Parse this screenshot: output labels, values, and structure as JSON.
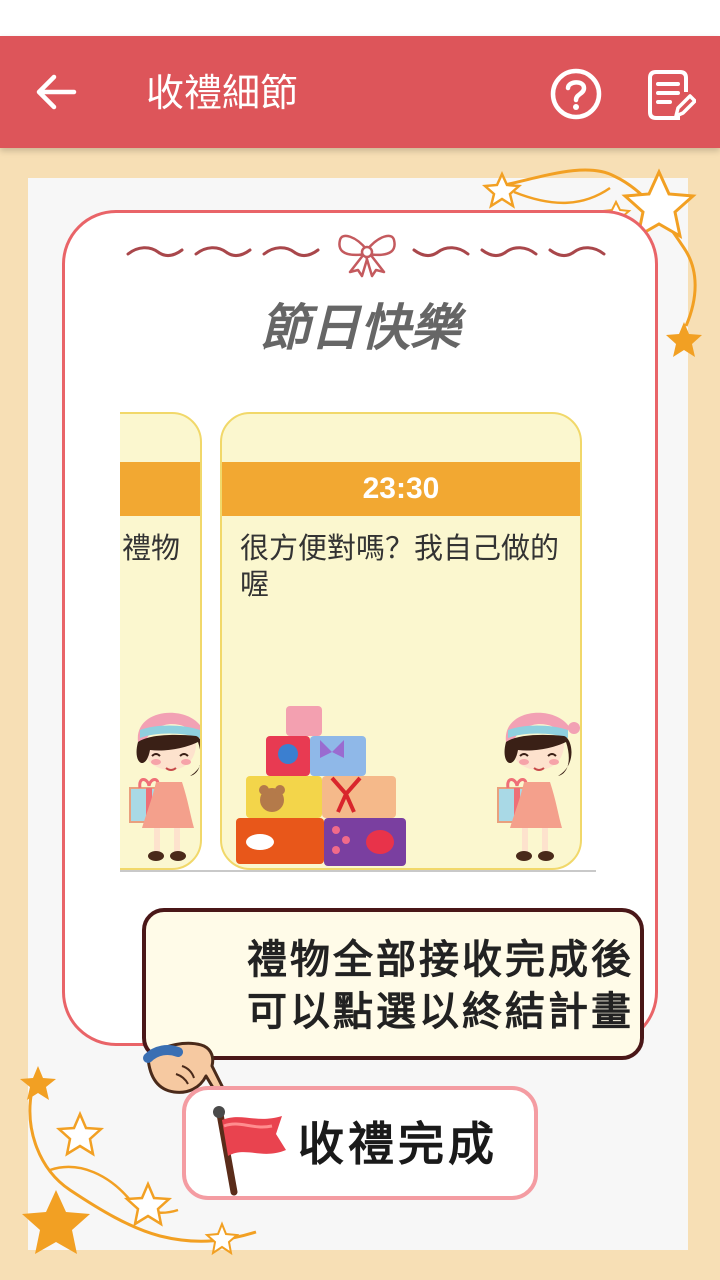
{
  "app_bar": {
    "title": "收禮細節",
    "back_icon": "back-arrow-icon",
    "help_icon": "question-circle-icon",
    "note_icon": "edit-note-icon"
  },
  "card": {
    "title": "節日快樂",
    "ribbon_icon": "bow-ribbon-icon"
  },
  "messages": [
    {
      "time": "",
      "text": "禮物"
    },
    {
      "time": "23:30",
      "text": "很方便對嗎？我自己做的喔"
    }
  ],
  "tip": {
    "line1": "禮物全部接收完成後",
    "line2": "可以點選以終結計畫"
  },
  "finish_button": {
    "label": "收禮完成",
    "icon": "red-flag-icon"
  },
  "colors": {
    "app_bar": "#dd555a",
    "card_border": "#e96468",
    "slide_header": "#f2a832",
    "slide_bg": "#fbf7cf",
    "page_bg": "#f7dfb5",
    "button_border": "#f49ca2"
  }
}
